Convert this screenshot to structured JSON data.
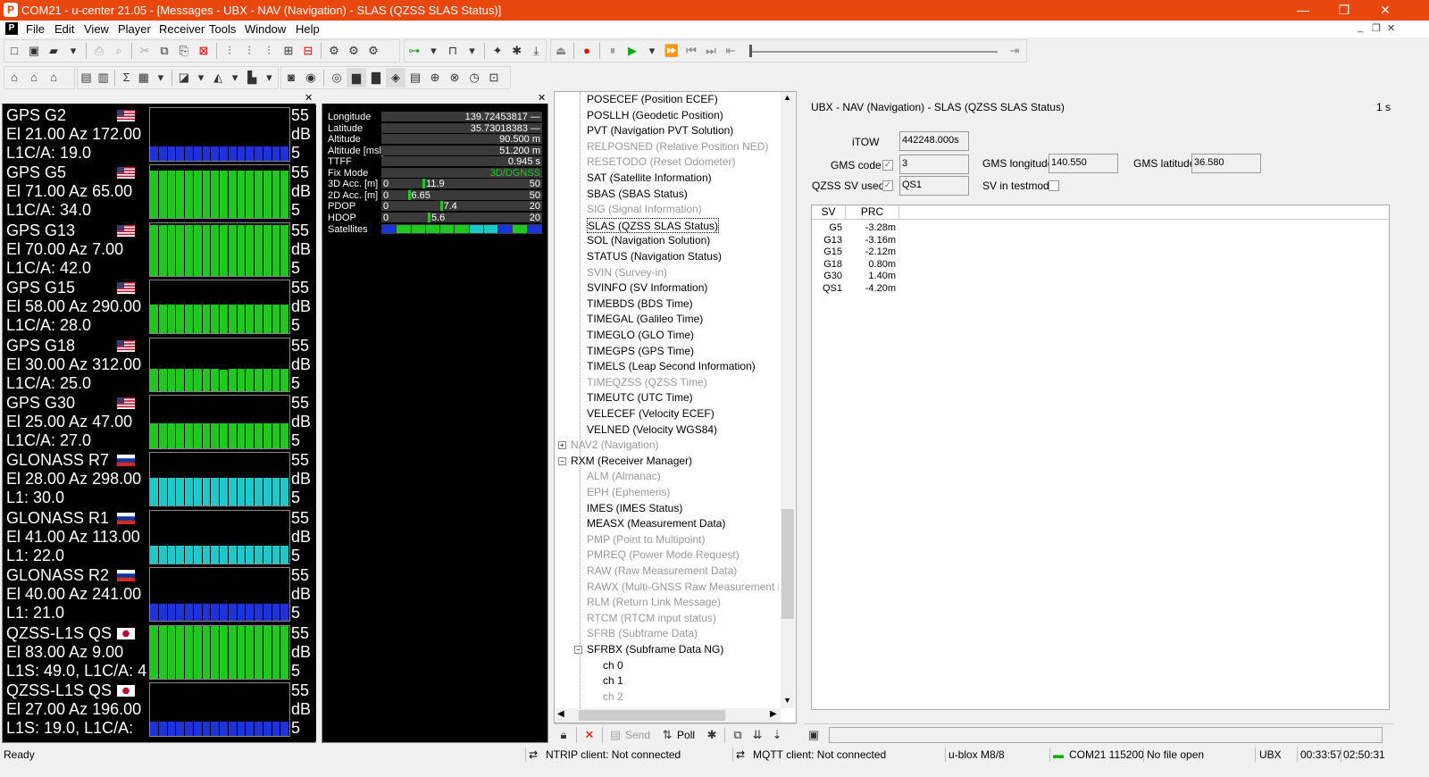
{
  "window": {
    "title": "COM21 - u-center 21.05 - [Messages - UBX - NAV (Navigation) - SLAS (QZSS SLAS Status)]",
    "min": "—",
    "restore": "❐",
    "close": "✕"
  },
  "menu": [
    "File",
    "Edit",
    "View",
    "Player",
    "Receiver",
    "Tools",
    "Window",
    "Help"
  ],
  "mdi": {
    "min": "_",
    "restore": "❐",
    "close": "✕"
  },
  "colors": {
    "green": "#1ec81e",
    "blue": "#1e32dc",
    "cyan": "#1ec8c8"
  },
  "satellites": [
    {
      "name": "GPS G2",
      "flag": "us",
      "elaz": "El 21.00 Az 172.00",
      "sig": "L1C/A: 19.0",
      "color": "blue",
      "levels": [
        0.27,
        0.27,
        0.27,
        0.27,
        0.27,
        0.27,
        0.27,
        0.27,
        0.27,
        0.27,
        0.27,
        0.27,
        0.27,
        0.27,
        0.27,
        0.27
      ]
    },
    {
      "name": "GPS G5",
      "flag": "us",
      "elaz": "El 71.00 Az 65.00",
      "sig": "L1C/A: 34.0",
      "color": "green",
      "levels": [
        0.9,
        0.9,
        0.9,
        0.9,
        0.9,
        0.9,
        0.9,
        0.9,
        0.9,
        0.9,
        0.9,
        0.9,
        0.9,
        0.9,
        0.9,
        0.9
      ]
    },
    {
      "name": "GPS G13",
      "flag": "us",
      "elaz": "El 70.00 Az 7.00",
      "sig": "L1C/A: 42.0",
      "color": "green",
      "levels": [
        0.97,
        0.97,
        0.97,
        0.97,
        0.97,
        0.97,
        0.97,
        0.97,
        0.97,
        0.97,
        0.97,
        0.97,
        0.97,
        0.97,
        0.97,
        0.97
      ]
    },
    {
      "name": "GPS G15",
      "flag": "us",
      "elaz": "El 58.00 Az 290.00",
      "sig": "L1C/A: 28.0",
      "color": "green",
      "levels": [
        0.55,
        0.55,
        0.55,
        0.55,
        0.55,
        0.55,
        0.55,
        0.55,
        0.55,
        0.55,
        0.55,
        0.55,
        0.55,
        0.55,
        0.55,
        0.55
      ]
    },
    {
      "name": "GPS G18",
      "flag": "us",
      "elaz": "El 30.00 Az 312.00",
      "sig": "L1C/A: 25.0",
      "color": "green",
      "levels": [
        0.42,
        0.42,
        0.42,
        0.42,
        0.42,
        0.42,
        0.42,
        0.42,
        0.4,
        0.42,
        0.42,
        0.42,
        0.42,
        0.42,
        0.42,
        0.42
      ]
    },
    {
      "name": "GPS G30",
      "flag": "us",
      "elaz": "El 25.00 Az 47.00",
      "sig": "L1C/A: 27.0",
      "color": "green",
      "levels": [
        0.47,
        0.47,
        0.47,
        0.47,
        0.47,
        0.47,
        0.47,
        0.47,
        0.47,
        0.47,
        0.47,
        0.47,
        0.47,
        0.47,
        0.47,
        0.47
      ]
    },
    {
      "name": "GLONASS R7",
      "flag": "ru",
      "elaz": "El 28.00 Az 298.00",
      "sig": "L1: 30.0",
      "color": "cyan",
      "levels": [
        0.53,
        0.53,
        0.53,
        0.53,
        0.53,
        0.53,
        0.53,
        0.53,
        0.53,
        0.53,
        0.53,
        0.53,
        0.53,
        0.53,
        0.53,
        0.53
      ]
    },
    {
      "name": "GLONASS R1",
      "flag": "ru",
      "elaz": "El 41.00 Az 113.00",
      "sig": "L1: 22.0",
      "color": "cyan",
      "levels": [
        0.33,
        0.33,
        0.33,
        0.33,
        0.33,
        0.33,
        0.33,
        0.33,
        0.33,
        0.33,
        0.33,
        0.33,
        0.33,
        0.33,
        0.33,
        0.33
      ]
    },
    {
      "name": "GLONASS R2",
      "flag": "ru",
      "elaz": "El 40.00 Az 241.00",
      "sig": "L1: 21.0",
      "color": "blue",
      "levels": [
        0.33,
        0.33,
        0.33,
        0.33,
        0.33,
        0.33,
        0.33,
        0.33,
        0.33,
        0.33,
        0.33,
        0.33,
        0.33,
        0.33,
        0.33,
        0.33
      ]
    },
    {
      "name": "QZSS-L1S QS",
      "flag": "jp",
      "elaz": "El 83.00 Az 9.00",
      "sig": "L1S: 49.0, L1C/A: 4",
      "color": "green",
      "levels": [
        1,
        1,
        1,
        1,
        1,
        1,
        1,
        1,
        1,
        1,
        1,
        1,
        1,
        1,
        1,
        1
      ]
    },
    {
      "name": "QZSS-L1S QS",
      "flag": "jp",
      "elaz": "El 27.00 Az 196.00",
      "sig": "L1S: 19.0, L1C/A:",
      "color": "blue",
      "levels": [
        0.27,
        0.27,
        0.27,
        0.27,
        0.27,
        0.27,
        0.27,
        0.27,
        0.27,
        0.27,
        0.27,
        0.27,
        0.27,
        0.27,
        0.27,
        0.27
      ]
    }
  ],
  "scale": {
    "top": "55",
    "unit": "dB",
    "bottom": "5"
  },
  "nav": {
    "longitude_label": "Longitude",
    "longitude": "139.72453817 —",
    "latitude_label": "Latitude",
    "latitude": "35.73018383 —",
    "altitude_label": "Altitude",
    "altitude": "90.500 m",
    "altmsl_label": "Altitude [msl]",
    "altmsl": "51.200 m",
    "ttff_label": "TTFF",
    "ttff": "0.945 s",
    "fix_label": "Fix Mode",
    "fix": "3D/DGNSS",
    "acc3d_label": "3D Acc. [m]",
    "acc3d_min": "0",
    "acc3d_val": "11.9",
    "acc3d_max": "50",
    "acc3d_frac": 0.24,
    "acc2d_label": "2D Acc. [m]",
    "acc2d_min": "0",
    "acc2d_val": "6.65",
    "acc2d_max": "50",
    "acc2d_frac": 0.13,
    "pdop_label": "PDOP",
    "pdop_min": "0",
    "pdop_val": "7.4",
    "pdop_max": "20",
    "pdop_frac": 0.37,
    "hdop_label": "HDOP",
    "hdop_min": "0",
    "hdop_val": "5.6",
    "hdop_max": "20",
    "hdop_frac": 0.28,
    "sats_label": "Satellites",
    "sat_colors": [
      "blue",
      "green",
      "green",
      "green",
      "green",
      "green",
      "cyan",
      "cyan",
      "blue",
      "green",
      "blue"
    ]
  },
  "tree": [
    {
      "label": "POSECEF (Position ECEF)",
      "lvl": 2,
      "g": false
    },
    {
      "label": "POSLLH (Geodetic Position)",
      "lvl": 2,
      "g": false
    },
    {
      "label": "PVT (Navigation PVT Solution)",
      "lvl": 2,
      "g": false
    },
    {
      "label": "RELPOSNED (Relative Position NED)",
      "lvl": 2,
      "g": true
    },
    {
      "label": "RESETODO (Reset Odometer)",
      "lvl": 2,
      "g": true
    },
    {
      "label": "SAT (Satellite Information)",
      "lvl": 2,
      "g": false
    },
    {
      "label": "SBAS (SBAS Status)",
      "lvl": 2,
      "g": false
    },
    {
      "label": "SIG (Signal Information)",
      "lvl": 2,
      "g": true
    },
    {
      "label": "SLAS (QZSS SLAS Status)",
      "lvl": 2,
      "g": false,
      "sel": true
    },
    {
      "label": "SOL (Navigation Solution)",
      "lvl": 2,
      "g": false
    },
    {
      "label": "STATUS (Navigation Status)",
      "lvl": 2,
      "g": false
    },
    {
      "label": "SVIN (Survey-in)",
      "lvl": 2,
      "g": true
    },
    {
      "label": "SVINFO (SV Information)",
      "lvl": 2,
      "g": false
    },
    {
      "label": "TIMEBDS (BDS Time)",
      "lvl": 2,
      "g": false
    },
    {
      "label": "TIMEGAL (Galileo Time)",
      "lvl": 2,
      "g": false
    },
    {
      "label": "TIMEGLO (GLO Time)",
      "lvl": 2,
      "g": false
    },
    {
      "label": "TIMEGPS (GPS Time)",
      "lvl": 2,
      "g": false
    },
    {
      "label": "TIMELS (Leap Second Information)",
      "lvl": 2,
      "g": false
    },
    {
      "label": "TIMEQZSS (QZSS Time)",
      "lvl": 2,
      "g": true
    },
    {
      "label": "TIMEUTC (UTC Time)",
      "lvl": 2,
      "g": false
    },
    {
      "label": "VELECEF (Velocity ECEF)",
      "lvl": 2,
      "g": false
    },
    {
      "label": "VELNED (Velocity WGS84)",
      "lvl": 2,
      "g": false
    },
    {
      "label": "NAV2 (Navigation)",
      "lvl": 1,
      "g": true,
      "exp": "+"
    },
    {
      "label": "RXM (Receiver Manager)",
      "lvl": 1,
      "g": false,
      "exp": "−"
    },
    {
      "label": "ALM (Almanac)",
      "lvl": 2,
      "g": true
    },
    {
      "label": "EPH (Ephemeris)",
      "lvl": 2,
      "g": true
    },
    {
      "label": "IMES (IMES Status)",
      "lvl": 2,
      "g": false
    },
    {
      "label": "MEASX (Measurement Data)",
      "lvl": 2,
      "g": false
    },
    {
      "label": "PMP (Point to Multipoint)",
      "lvl": 2,
      "g": true
    },
    {
      "label": "PMREQ (Power Mode Request)",
      "lvl": 2,
      "g": true
    },
    {
      "label": "RAW (Raw Measurement Data)",
      "lvl": 2,
      "g": true
    },
    {
      "label": "RAWX (Multi-GNSS Raw Measurement Da",
      "lvl": 2,
      "g": true
    },
    {
      "label": "RLM (Return Link Message)",
      "lvl": 2,
      "g": true
    },
    {
      "label": "RTCM (RTCM input status)",
      "lvl": 2,
      "g": true
    },
    {
      "label": "SFRB (Subframe Data)",
      "lvl": 2,
      "g": true
    },
    {
      "label": "SFRBX (Subframe Data NG)",
      "lvl": 2,
      "g": false,
      "exp": "−"
    },
    {
      "label": "ch  0",
      "lvl": 3,
      "g": false
    },
    {
      "label": "ch  1",
      "lvl": 3,
      "g": false
    },
    {
      "label": "ch  2",
      "lvl": 3,
      "g": true
    }
  ],
  "detail": {
    "title": "UBX - NAV (Navigation) - SLAS (QZSS SLAS Status)",
    "rate": "1 s",
    "itow_label": "iTOW",
    "itow": "442248.000s",
    "gms_code_label": "GMS code",
    "gms_code": "3",
    "gms_lon_label": "GMS longitude",
    "gms_lon": "140.550",
    "gms_lat_label": "GMS latitude",
    "gms_lat": "36.580",
    "qzss_label": "QZSS SV used",
    "qzss": "QS1",
    "testmode_label": "SV in testmode",
    "check": "✓",
    "col_sv": "SV",
    "col_prc": "PRC",
    "rows": [
      [
        "G5",
        "-3.28m"
      ],
      [
        "G13",
        "-3.16m"
      ],
      [
        "G15",
        "-2.12m"
      ],
      [
        "G18",
        "0.80m"
      ],
      [
        "G30",
        "1.40m"
      ],
      [
        "QS1",
        "-4.20m"
      ]
    ]
  },
  "bottom": {
    "send": "Send",
    "poll": "Poll"
  },
  "status": {
    "ready": "Ready",
    "ntrip": "NTRIP client: Not connected",
    "mqtt": "MQTT client: Not connected",
    "device": "u-blox M8/8",
    "port": "COM21 115200",
    "file": "No file open",
    "proto": "UBX",
    "t1": "00:33:57",
    "t2": "02:50:31"
  }
}
